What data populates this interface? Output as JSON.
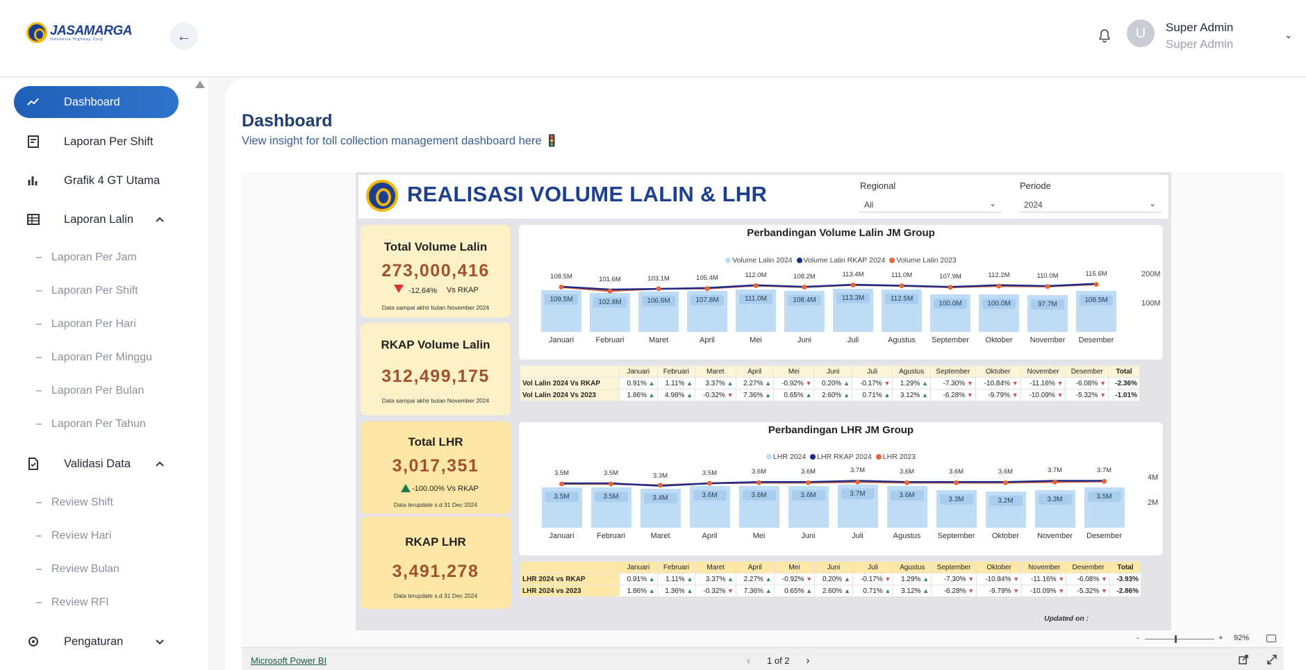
{
  "brand": {
    "name": "JASAMARGA",
    "tagline": "Indonesia Highway Corp"
  },
  "user": {
    "initial": "U",
    "name": "Super Admin",
    "role": "Super Admin"
  },
  "sidebar": {
    "items": [
      {
        "label": "Dashboard",
        "icon": "trend-icon"
      },
      {
        "label": "Laporan Per Shift",
        "icon": "report-icon"
      },
      {
        "label": "Grafik 4 GT Utama",
        "icon": "bar-chart-icon"
      },
      {
        "label": "Laporan Lalin",
        "icon": "table-icon"
      },
      {
        "label": "Validasi Data",
        "icon": "document-check-icon"
      },
      {
        "label": "Pengaturan",
        "icon": "settings-icon"
      }
    ],
    "lalin_sub": [
      "Laporan Per Jam",
      "Laporan Per Shift",
      "Laporan Per Hari",
      "Laporan Per Minggu",
      "Laporan Per Bulan",
      "Laporan Per Tahun"
    ],
    "validasi_sub": [
      "Review Shift",
      "Review Hari",
      "Review Bulan",
      "Review RFI"
    ]
  },
  "page": {
    "title": "Dashboard",
    "subtitle": "View insight for toll collection management dashboard here 🚦"
  },
  "report": {
    "title": "REALISASI VOLUME LALIN & LHR",
    "filters": {
      "regional_label": "Regional",
      "regional_value": "All",
      "periode_label": "Periode",
      "periode_value": "2024"
    },
    "cards": {
      "total_volume": {
        "title": "Total Volume Lalin",
        "value": "273,000,416",
        "change": "-12.64%",
        "vs": "Vs RKAP",
        "note": "Data sampai akhir bulan November 2024"
      },
      "rkap_volume": {
        "title": "RKAP Volume Lalin",
        "value": "312,499,175",
        "note": "Data sampai akhir bulan November 2024"
      },
      "total_lhr": {
        "title": "Total LHR",
        "value": "3,017,351",
        "change": "-100.00% Vs RKAP",
        "note": "Data terupdate s.d 31 Dec 2024"
      },
      "rkap_lhr": {
        "title": "RKAP LHR",
        "value": "3,491,278",
        "note": "Data terupdate s.d 31 Dec 2024"
      }
    },
    "updated_label": "Updated on :",
    "colors": {
      "bar": "#bfdcf7",
      "rkap": "#1a2a8a",
      "prev": "#e8643a"
    }
  },
  "months": [
    "Januari",
    "Februari",
    "Maret",
    "April",
    "Mei",
    "Juni",
    "Juli",
    "Agustus",
    "September",
    "Oktober",
    "November",
    "Desember"
  ],
  "chart_data": [
    {
      "type": "bar",
      "title": "Perbandingan Volume Lalin JM Group",
      "categories": [
        "Januari",
        "Februari",
        "Maret",
        "April",
        "Mei",
        "Juni",
        "Juli",
        "Agustus",
        "September",
        "Oktober",
        "November",
        "Desember"
      ],
      "series": [
        {
          "name": "Volume Lalin 2024",
          "values": [
            109.5,
            102.8,
            106.6,
            107.8,
            111.0,
            108.4,
            113.3,
            112.5,
            100.0,
            100.0,
            97.7,
            108.5
          ],
          "labels": [
            "109.5M",
            "102.8M",
            "106.6M",
            "107.8M",
            "111.0M",
            "108.4M",
            "113.3M",
            "112.5M",
            "100.0M",
            "100.0M",
            "97.7M",
            "108.5M"
          ]
        },
        {
          "name": "Volume Lalin RKAP 2024",
          "values": [
            108.5,
            101.6,
            103.1,
            105.4,
            112.0,
            108.2,
            113.4,
            111.0,
            107.9,
            112.2,
            110.0,
            115.6
          ],
          "labels": [
            "108.5M",
            "101.6M",
            "103.1M",
            "105.4M",
            "112.0M",
            "108.2M",
            "113.4M",
            "111.0M",
            "107.9M",
            "112.2M",
            "110.0M",
            "115.6M"
          ]
        },
        {
          "name": "Volume Lalin 2023",
          "values": [
            107.5,
            98.0,
            103.5,
            104.0,
            111.0,
            107.5,
            112.5,
            110.5,
            107.0,
            110.0,
            109.0,
            114.0
          ]
        }
      ],
      "yticks": [
        "200M",
        "100M"
      ],
      "ylim": [
        0,
        200
      ]
    },
    {
      "type": "bar",
      "title": "Perbandingan LHR JM Group",
      "categories": [
        "Januari",
        "Februari",
        "Maret",
        "April",
        "Mei",
        "Juni",
        "Juli",
        "Agustus",
        "September",
        "Oktober",
        "November",
        "Desember"
      ],
      "series": [
        {
          "name": "LHR 2024",
          "values": [
            3.5,
            3.5,
            3.4,
            3.6,
            3.6,
            3.6,
            3.7,
            3.6,
            3.3,
            3.2,
            3.3,
            3.5
          ],
          "labels": [
            "3.5M",
            "3.5M",
            "3.4M",
            "3.6M",
            "3.6M",
            "3.6M",
            "3.7M",
            "3.6M",
            "3.3M",
            "3.2M",
            "3.3M",
            "3.5M"
          ]
        },
        {
          "name": "LHR RKAP 2024",
          "values": [
            3.5,
            3.5,
            3.3,
            3.5,
            3.6,
            3.6,
            3.7,
            3.6,
            3.6,
            3.6,
            3.7,
            3.7
          ],
          "labels": [
            "3.5M",
            "3.5M",
            "3.3M",
            "3.5M",
            "3.6M",
            "3.6M",
            "3.7M",
            "3.6M",
            "3.6M",
            "3.6M",
            "3.7M",
            "3.7M"
          ]
        },
        {
          "name": "LHR 2023",
          "values": [
            3.45,
            3.45,
            3.35,
            3.5,
            3.55,
            3.55,
            3.6,
            3.55,
            3.55,
            3.55,
            3.6,
            3.65
          ]
        }
      ],
      "yticks": [
        "4M",
        "2M",
        ""
      ],
      "ylim": [
        0,
        4
      ]
    }
  ],
  "table_volume": {
    "total_label": "Total",
    "rows": [
      {
        "label": "Vol Lalin 2024 Vs RKAP",
        "cells": [
          "0.91%",
          "1.11%",
          "3.37%",
          "2.27%",
          "-0.92%",
          "0.20%",
          "-0.17%",
          "1.29%",
          "-7.30%",
          "-10.84%",
          "-11.16%",
          "-6.08%"
        ],
        "dirs": [
          "up",
          "up",
          "up",
          "up",
          "dn",
          "up",
          "dn",
          "up",
          "dn",
          "dn",
          "dn",
          "dn"
        ],
        "total": "-2.36%"
      },
      {
        "label": "Vol Lalin 2024 Vs 2023",
        "cells": [
          "1.86%",
          "4.98%",
          "-0.32%",
          "7.36%",
          "0.65%",
          "2.60%",
          "0.71%",
          "3.12%",
          "-6.28%",
          "-9.79%",
          "-10.09%",
          "-5.32%"
        ],
        "dirs": [
          "up",
          "up",
          "dn",
          "up",
          "up",
          "up",
          "up",
          "up",
          "dn",
          "dn",
          "dn",
          "dn"
        ],
        "total": "-1.01%"
      }
    ]
  },
  "table_lhr": {
    "total_label": "Total",
    "rows": [
      {
        "label": "LHR 2024 vs RKAP",
        "cells": [
          "0.91%",
          "1.11%",
          "3.37%",
          "2.27%",
          "-0.92%",
          "0.20%",
          "-0.17%",
          "1.29%",
          "-7.30%",
          "-10.84%",
          "-11.16%",
          "-6.08%"
        ],
        "dirs": [
          "up",
          "up",
          "up",
          "up",
          "dn",
          "up",
          "dn",
          "up",
          "dn",
          "dn",
          "dn",
          "dn"
        ],
        "total": "-3.93%"
      },
      {
        "label": "LHR 2024 vs 2023",
        "cells": [
          "1.86%",
          "1.36%",
          "-0.32%",
          "7.36%",
          "0.65%",
          "2.60%",
          "0.71%",
          "3.12%",
          "-6.28%",
          "-9.79%",
          "-10.09%",
          "-5.32%"
        ],
        "dirs": [
          "up",
          "up",
          "dn",
          "up",
          "up",
          "up",
          "up",
          "up",
          "dn",
          "dn",
          "dn",
          "dn"
        ],
        "total": "-2.86%"
      }
    ]
  },
  "footer": {
    "link": "Microsoft Power BI",
    "pager": "1 of 2",
    "zoom": "92%",
    "zoom_minus": "-",
    "zoom_plus": "+"
  }
}
